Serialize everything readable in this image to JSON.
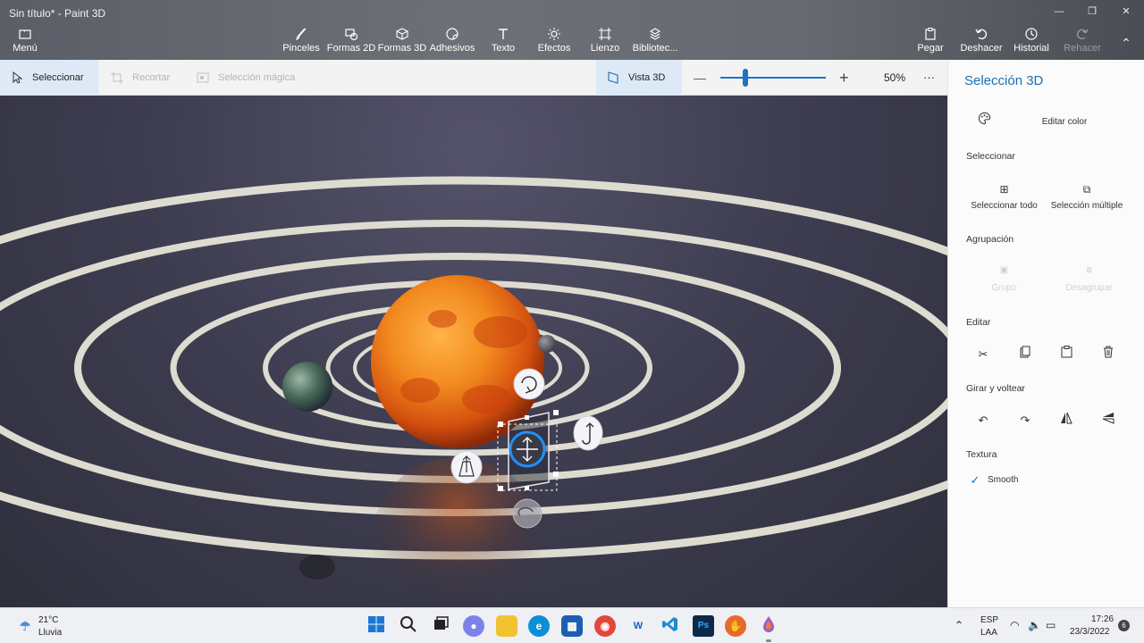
{
  "window": {
    "title": "Sin título* - Paint 3D"
  },
  "commandbar": {
    "menu": "Menú",
    "tools": [
      "Pinceles",
      "Formas 2D",
      "Formas 3D",
      "Adhesivos",
      "Texto",
      "Efectos",
      "Lienzo",
      "Bibliotec..."
    ],
    "right": [
      "Pegar",
      "Deshacer",
      "Historial",
      "Rehacer"
    ]
  },
  "toolbar": {
    "select": "Seleccionar",
    "crop": "Recortar",
    "magic": "Selección mágica",
    "view3d": "Vista 3D",
    "zoom_minus": "—",
    "zoom_plus": "+",
    "zoom": "50%",
    "zoom_value": 0.24,
    "more": "···"
  },
  "panel": {
    "title": "Selección 3D",
    "edit_color": "Editar color",
    "select_section": "Seleccionar",
    "select_all": "Seleccionar todo",
    "multi_select": "Selección múltiple",
    "group_section": "Agrupación",
    "group": "Grupo",
    "ungroup": "Desagrupar",
    "edit_section": "Editar",
    "rotate_section": "Girar y voltear",
    "texture_section": "Textura",
    "texture_value": "Smooth",
    "accent": "#1a6fb7"
  },
  "taskbar": {
    "weather_temp": "21°C",
    "weather_desc": "Lluvia",
    "lang1": "ESP",
    "lang2": "LAA",
    "time": "17:26",
    "date": "23/3/2022",
    "notifications": "6",
    "apps": [
      "windows-start-icon",
      "search-icon",
      "task-view-icon",
      "teams-chat-icon",
      "file-explorer-icon",
      "edge-icon",
      "store-icon",
      "chrome-icon",
      "word-icon",
      "vscode-icon",
      "photoshop-icon",
      "app-icon",
      "paint3d-icon"
    ]
  }
}
